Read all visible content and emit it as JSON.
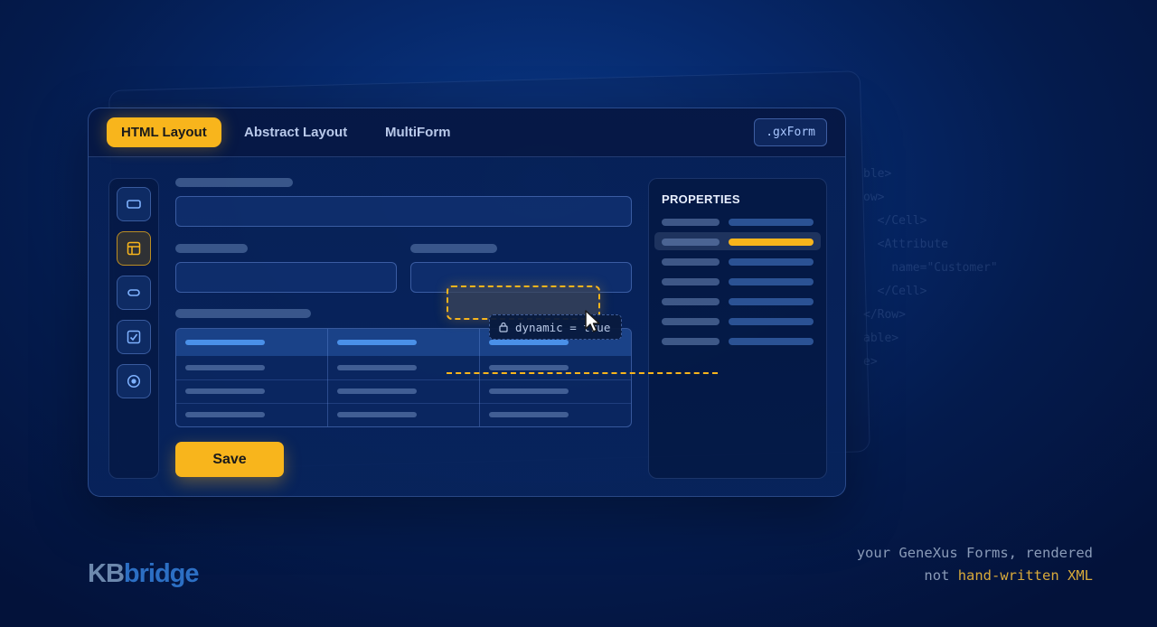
{
  "tabs": [
    {
      "label": "HTML Layout",
      "active": true
    },
    {
      "label": "Abstract Layout",
      "active": false
    },
    {
      "label": "MultiForm",
      "active": false
    }
  ],
  "file_badge": ".gxForm",
  "toolbox": {
    "items": [
      {
        "icon": "textbox-icon"
      },
      {
        "icon": "layout-table-icon",
        "active": true
      },
      {
        "icon": "button-icon"
      },
      {
        "icon": "checkbox-icon"
      },
      {
        "icon": "radio-icon"
      }
    ]
  },
  "form": {
    "save_label": "Save"
  },
  "drag": {
    "chip_text": "dynamic = true"
  },
  "properties": {
    "title": "PROPERTIES",
    "selected_row": 2
  },
  "background_code": [
    "ble>",
    "ow>",
    "  </Cell>",
    "  <Attribute",
    "    name=\"Customer\"",
    "  </Cell>",
    "</Row>",
    "able>",
    "e>"
  ],
  "brand": {
    "logo_kb": "KB",
    "logo_bridge": "bridge",
    "tagline_line1": "your GeneXus Forms, rendered",
    "tagline_not": "not ",
    "tagline_highlight": "hand-written XML"
  },
  "colors": {
    "accent": "#f8b51c",
    "background": "#06286a",
    "link_blue": "#4a90e8"
  }
}
